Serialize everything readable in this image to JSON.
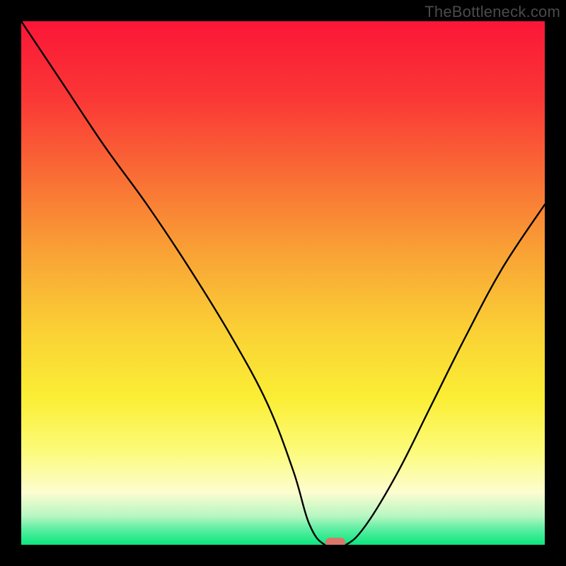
{
  "watermark": "TheBottleneck.com",
  "chart_data": {
    "type": "line",
    "title": "",
    "xlabel": "",
    "ylabel": "",
    "xlim": [
      0,
      100
    ],
    "ylim": [
      0,
      100
    ],
    "grid": false,
    "legend": false,
    "series": [
      {
        "name": "curve",
        "x": [
          0,
          8,
          16,
          24,
          32,
          40,
          47,
          52,
          55,
          58,
          62,
          66,
          72,
          78,
          85,
          92,
          100
        ],
        "values": [
          100,
          88,
          76,
          65,
          53,
          40,
          27,
          14,
          4,
          0,
          0,
          4,
          14,
          26,
          40,
          53,
          65
        ]
      }
    ],
    "marker": {
      "x_percent": 60,
      "y_percent": 0,
      "color": "#d9776b"
    },
    "background_gradient": {
      "stops": [
        {
          "offset": 0.0,
          "color": "#fb1637"
        },
        {
          "offset": 0.15,
          "color": "#fa3836"
        },
        {
          "offset": 0.3,
          "color": "#f96f35"
        },
        {
          "offset": 0.45,
          "color": "#f9a535"
        },
        {
          "offset": 0.6,
          "color": "#fad335"
        },
        {
          "offset": 0.72,
          "color": "#fbee35"
        },
        {
          "offset": 0.82,
          "color": "#fcfb79"
        },
        {
          "offset": 0.9,
          "color": "#fdfdd0"
        },
        {
          "offset": 0.945,
          "color": "#b7f6c2"
        },
        {
          "offset": 0.97,
          "color": "#5ceea1"
        },
        {
          "offset": 1.0,
          "color": "#0be77f"
        }
      ]
    }
  }
}
